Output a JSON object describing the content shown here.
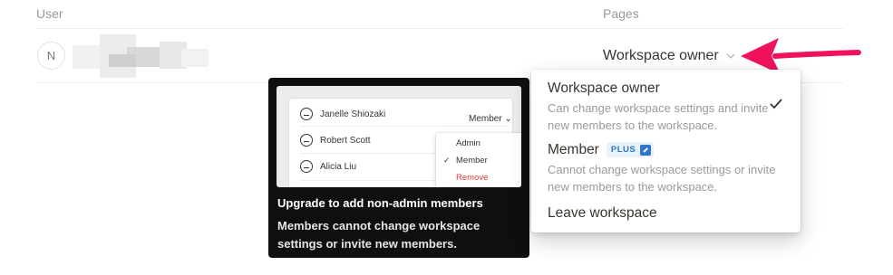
{
  "table": {
    "headers": {
      "user": "User",
      "pages": "Pages"
    },
    "row": {
      "avatar_initial": "N",
      "role": "Workspace owner"
    }
  },
  "tooltip": {
    "preview": {
      "members": [
        "Janelle Shiozaki",
        "Robert Scott",
        "Alicia Liu"
      ],
      "current_role": "Member",
      "menu": {
        "admin": "Admin",
        "member": "Member",
        "remove": "Remove"
      }
    },
    "title": "Upgrade to add non-admin members",
    "body": "Members cannot change workspace settings or invite new members."
  },
  "dropdown": {
    "owner": {
      "title": "Workspace owner",
      "description": "Can change workspace settings and invite new members to the workspace.",
      "selected": true
    },
    "member": {
      "title": "Member",
      "badge": "PLUS",
      "description": "Cannot change workspace settings or invite new members to the workspace."
    },
    "leave": "Leave workspace"
  },
  "colors": {
    "arrow": "#f0125c",
    "plus_badge": "#2e75cc",
    "remove": "#e03e3e",
    "tooltip_bg": "#0f0f0f"
  }
}
